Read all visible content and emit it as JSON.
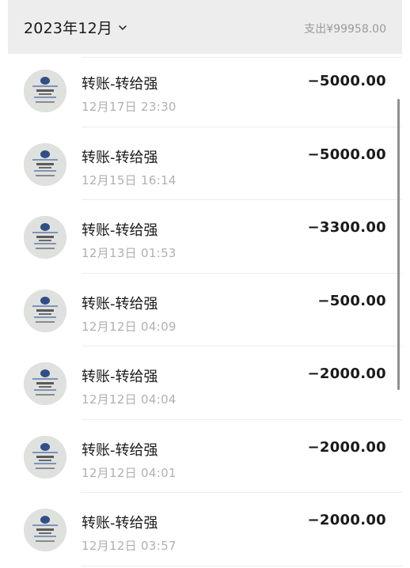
{
  "header": {
    "month": "2023年12月",
    "summary": "支出¥99958.00"
  },
  "transactions": [
    {
      "title": "转账-转给强",
      "time": "12月17日 23:30",
      "amount": "−5000.00"
    },
    {
      "title": "转账-转给强",
      "time": "12月15日 16:14",
      "amount": "−5000.00"
    },
    {
      "title": "转账-转给强",
      "time": "12月13日 01:53",
      "amount": "−3300.00"
    },
    {
      "title": "转账-转给强",
      "time": "12月12日 04:09",
      "amount": "−500.00"
    },
    {
      "title": "转账-转给强",
      "time": "12月12日 04:04",
      "amount": "−2000.00"
    },
    {
      "title": "转账-转给强",
      "time": "12月12日 04:01",
      "amount": "−2000.00"
    },
    {
      "title": "转账-转给强",
      "time": "12月12日 03:57",
      "amount": "−2000.00"
    }
  ],
  "icons": {
    "month_dropdown": "chevron-down-icon",
    "avatar": "avatar-image"
  }
}
